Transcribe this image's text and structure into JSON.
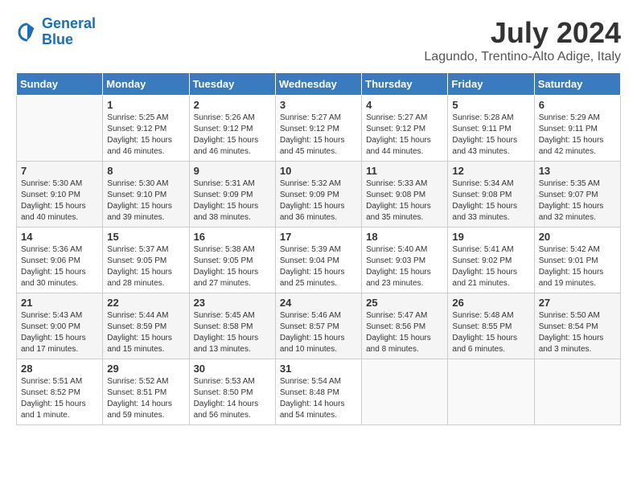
{
  "header": {
    "logo_line1": "General",
    "logo_line2": "Blue",
    "month": "July 2024",
    "location": "Lagundo, Trentino-Alto Adige, Italy"
  },
  "days_of_week": [
    "Sunday",
    "Monday",
    "Tuesday",
    "Wednesday",
    "Thursday",
    "Friday",
    "Saturday"
  ],
  "weeks": [
    [
      {
        "day": "",
        "info": ""
      },
      {
        "day": "1",
        "info": "Sunrise: 5:25 AM\nSunset: 9:12 PM\nDaylight: 15 hours\nand 46 minutes."
      },
      {
        "day": "2",
        "info": "Sunrise: 5:26 AM\nSunset: 9:12 PM\nDaylight: 15 hours\nand 46 minutes."
      },
      {
        "day": "3",
        "info": "Sunrise: 5:27 AM\nSunset: 9:12 PM\nDaylight: 15 hours\nand 45 minutes."
      },
      {
        "day": "4",
        "info": "Sunrise: 5:27 AM\nSunset: 9:12 PM\nDaylight: 15 hours\nand 44 minutes."
      },
      {
        "day": "5",
        "info": "Sunrise: 5:28 AM\nSunset: 9:11 PM\nDaylight: 15 hours\nand 43 minutes."
      },
      {
        "day": "6",
        "info": "Sunrise: 5:29 AM\nSunset: 9:11 PM\nDaylight: 15 hours\nand 42 minutes."
      }
    ],
    [
      {
        "day": "7",
        "info": "Sunrise: 5:30 AM\nSunset: 9:10 PM\nDaylight: 15 hours\nand 40 minutes."
      },
      {
        "day": "8",
        "info": "Sunrise: 5:30 AM\nSunset: 9:10 PM\nDaylight: 15 hours\nand 39 minutes."
      },
      {
        "day": "9",
        "info": "Sunrise: 5:31 AM\nSunset: 9:09 PM\nDaylight: 15 hours\nand 38 minutes."
      },
      {
        "day": "10",
        "info": "Sunrise: 5:32 AM\nSunset: 9:09 PM\nDaylight: 15 hours\nand 36 minutes."
      },
      {
        "day": "11",
        "info": "Sunrise: 5:33 AM\nSunset: 9:08 PM\nDaylight: 15 hours\nand 35 minutes."
      },
      {
        "day": "12",
        "info": "Sunrise: 5:34 AM\nSunset: 9:08 PM\nDaylight: 15 hours\nand 33 minutes."
      },
      {
        "day": "13",
        "info": "Sunrise: 5:35 AM\nSunset: 9:07 PM\nDaylight: 15 hours\nand 32 minutes."
      }
    ],
    [
      {
        "day": "14",
        "info": "Sunrise: 5:36 AM\nSunset: 9:06 PM\nDaylight: 15 hours\nand 30 minutes."
      },
      {
        "day": "15",
        "info": "Sunrise: 5:37 AM\nSunset: 9:05 PM\nDaylight: 15 hours\nand 28 minutes."
      },
      {
        "day": "16",
        "info": "Sunrise: 5:38 AM\nSunset: 9:05 PM\nDaylight: 15 hours\nand 27 minutes."
      },
      {
        "day": "17",
        "info": "Sunrise: 5:39 AM\nSunset: 9:04 PM\nDaylight: 15 hours\nand 25 minutes."
      },
      {
        "day": "18",
        "info": "Sunrise: 5:40 AM\nSunset: 9:03 PM\nDaylight: 15 hours\nand 23 minutes."
      },
      {
        "day": "19",
        "info": "Sunrise: 5:41 AM\nSunset: 9:02 PM\nDaylight: 15 hours\nand 21 minutes."
      },
      {
        "day": "20",
        "info": "Sunrise: 5:42 AM\nSunset: 9:01 PM\nDaylight: 15 hours\nand 19 minutes."
      }
    ],
    [
      {
        "day": "21",
        "info": "Sunrise: 5:43 AM\nSunset: 9:00 PM\nDaylight: 15 hours\nand 17 minutes."
      },
      {
        "day": "22",
        "info": "Sunrise: 5:44 AM\nSunset: 8:59 PM\nDaylight: 15 hours\nand 15 minutes."
      },
      {
        "day": "23",
        "info": "Sunrise: 5:45 AM\nSunset: 8:58 PM\nDaylight: 15 hours\nand 13 minutes."
      },
      {
        "day": "24",
        "info": "Sunrise: 5:46 AM\nSunset: 8:57 PM\nDaylight: 15 hours\nand 10 minutes."
      },
      {
        "day": "25",
        "info": "Sunrise: 5:47 AM\nSunset: 8:56 PM\nDaylight: 15 hours\nand 8 minutes."
      },
      {
        "day": "26",
        "info": "Sunrise: 5:48 AM\nSunset: 8:55 PM\nDaylight: 15 hours\nand 6 minutes."
      },
      {
        "day": "27",
        "info": "Sunrise: 5:50 AM\nSunset: 8:54 PM\nDaylight: 15 hours\nand 3 minutes."
      }
    ],
    [
      {
        "day": "28",
        "info": "Sunrise: 5:51 AM\nSunset: 8:52 PM\nDaylight: 15 hours\nand 1 minute."
      },
      {
        "day": "29",
        "info": "Sunrise: 5:52 AM\nSunset: 8:51 PM\nDaylight: 14 hours\nand 59 minutes."
      },
      {
        "day": "30",
        "info": "Sunrise: 5:53 AM\nSunset: 8:50 PM\nDaylight: 14 hours\nand 56 minutes."
      },
      {
        "day": "31",
        "info": "Sunrise: 5:54 AM\nSunset: 8:48 PM\nDaylight: 14 hours\nand 54 minutes."
      },
      {
        "day": "",
        "info": ""
      },
      {
        "day": "",
        "info": ""
      },
      {
        "day": "",
        "info": ""
      }
    ]
  ]
}
